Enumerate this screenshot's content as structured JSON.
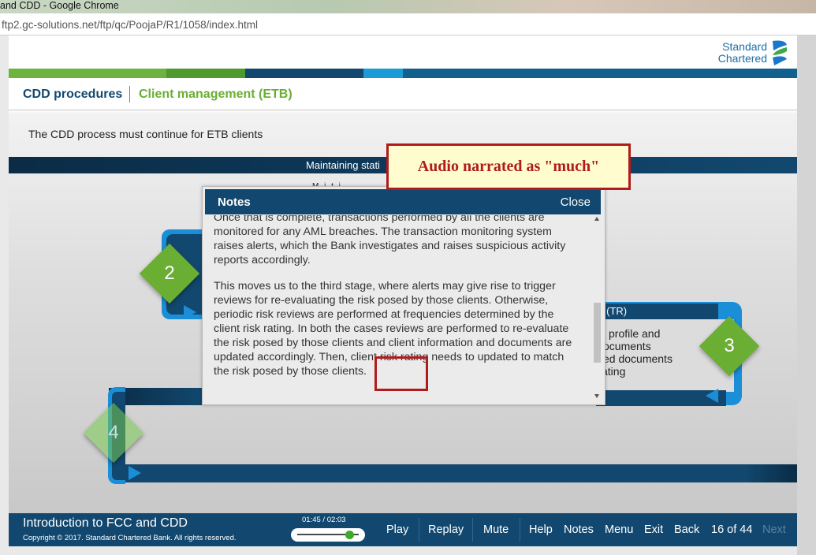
{
  "window": {
    "title": "and CDD - Google Chrome"
  },
  "address_bar": {
    "url": "ftp2.gc-solutions.net/ftp/qc/PoojaP/R1/1058/index.html"
  },
  "brand": {
    "line1": "Standard",
    "line2": "Chartered"
  },
  "breadcrumb": {
    "section": "CDD procedures",
    "topic": "Client management (ETB)"
  },
  "intro_text": "The CDD process must continue for ETB clients",
  "diagram": {
    "stage1_label": "Maintaining stati",
    "stage1_fragment": "M i t i",
    "stage3_label": "s (TR)",
    "stage3_lines": [
      "profile and",
      "ocuments",
      "ed documents",
      "ating"
    ],
    "steps": [
      "2",
      "3",
      "4"
    ]
  },
  "notes": {
    "title": "Notes",
    "close_label": "Close",
    "paragraphs": [
      "Once that is complete, transactions performed by all the clients are monitored for any AML breaches. The transaction monitoring system raises alerts, which the Bank investigates and raises suspicious activity reports accordingly.",
      "This moves us to the third stage, where alerts may give rise to trigger reviews for re-evaluating the risk posed by those clients. Otherwise, periodic risk reviews are performed at frequencies determined by the client risk rating. In both the cases reviews are performed to re-evaluate the risk posed by those clients and client information and documents are updated accordingly. Then, client risk rating needs to updated to match the risk posed by those clients."
    ]
  },
  "annotation": {
    "text": "Audio narrated as \"much\""
  },
  "footer": {
    "course_title": "Introduction to FCC and CDD",
    "copyright": "Copyright © 2017. Standard Chartered Bank. All rights reserved.",
    "timecode": "01:45 / 02:03",
    "progress_fraction": 0.854,
    "buttons": {
      "play": "Play",
      "replay": "Replay",
      "mute": "Mute",
      "help": "Help",
      "notes": "Notes",
      "menu": "Menu",
      "exit": "Exit",
      "back": "Back",
      "next": "Next"
    },
    "page_indicator": "16 of 44"
  },
  "colors": {
    "navy": "#12486f",
    "green": "#6aae33",
    "accent_blue": "#1a8fd8",
    "annotation_red": "#b01b1b"
  }
}
